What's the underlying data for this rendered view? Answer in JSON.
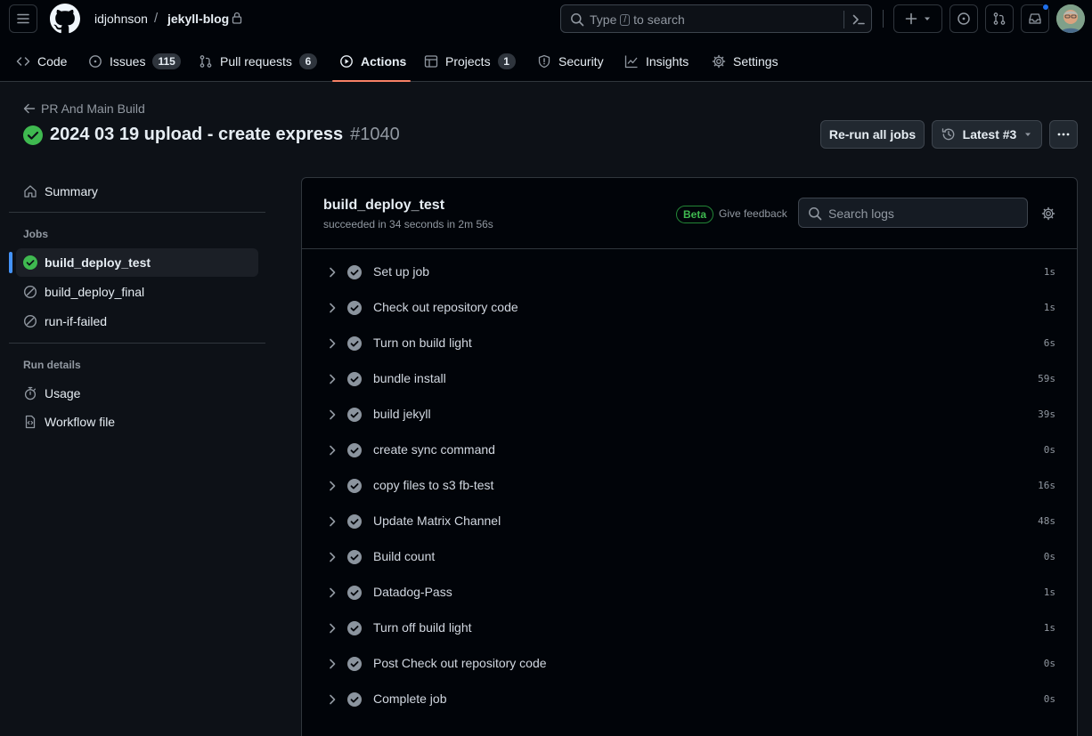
{
  "header": {
    "owner": "idjohnson",
    "separator": "/",
    "repo": "jekyll-blog",
    "search": {
      "prefix": "Type",
      "key": "/",
      "suffix": "to search"
    },
    "icons": [
      "hamburger-icon",
      "github-logo-icon",
      "lock-icon",
      "search-icon",
      "command-palette-icon",
      "plus-icon",
      "caret-down-icon",
      "issue-icon",
      "pull-request-icon",
      "inbox-icon",
      "avatar"
    ]
  },
  "repo_nav": {
    "items": [
      {
        "label": "Code",
        "icon": "code-icon"
      },
      {
        "label": "Issues",
        "count": "115",
        "icon": "issue-opened-icon"
      },
      {
        "label": "Pull requests",
        "count": "6",
        "icon": "git-pull-request-icon"
      },
      {
        "label": "Actions",
        "icon": "play-icon",
        "active": true
      },
      {
        "label": "Projects",
        "count": "1",
        "icon": "table-icon"
      },
      {
        "label": "Security",
        "icon": "shield-icon"
      },
      {
        "label": "Insights",
        "icon": "graph-icon"
      },
      {
        "label": "Settings",
        "icon": "gear-icon"
      }
    ]
  },
  "run": {
    "back_label": "PR And Main Build",
    "title": "2024 03 19 upload - create express",
    "number": "#1040",
    "rerun_label": "Re-run all jobs",
    "attempt_label": "Latest #3"
  },
  "sidebar": {
    "summary": "Summary",
    "jobs_heading": "Jobs",
    "jobs": [
      {
        "label": "build_deploy_test",
        "status": "success",
        "active": true
      },
      {
        "label": "build_deploy_final",
        "status": "skipped"
      },
      {
        "label": "run-if-failed",
        "status": "skipped"
      }
    ],
    "run_details_heading": "Run details",
    "usage": "Usage",
    "workflow_file": "Workflow file"
  },
  "job": {
    "name": "build_deploy_test",
    "status": "succeeded in 34 seconds in 2m 56s",
    "beta": "Beta",
    "feedback": "Give feedback",
    "search_placeholder": "Search logs",
    "steps": [
      {
        "label": "Set up job",
        "duration": "1s"
      },
      {
        "label": "Check out repository code",
        "duration": "1s"
      },
      {
        "label": "Turn on build light",
        "duration": "6s"
      },
      {
        "label": "bundle install",
        "duration": "59s"
      },
      {
        "label": "build jekyll",
        "duration": "39s"
      },
      {
        "label": "create sync command",
        "duration": "0s"
      },
      {
        "label": "copy files to s3 fb-test",
        "duration": "16s"
      },
      {
        "label": "Update Matrix Channel",
        "duration": "48s"
      },
      {
        "label": "Build count",
        "duration": "0s"
      },
      {
        "label": "Datadog-Pass",
        "duration": "1s"
      },
      {
        "label": "Turn off build light",
        "duration": "1s"
      },
      {
        "label": "Post Check out repository code",
        "duration": "0s"
      },
      {
        "label": "Complete job",
        "duration": "0s"
      }
    ]
  },
  "colors": {
    "accent_underline": "#f78166",
    "success": "#3fb950",
    "active_bar": "#4493f8",
    "notification": "#1f6feb"
  }
}
